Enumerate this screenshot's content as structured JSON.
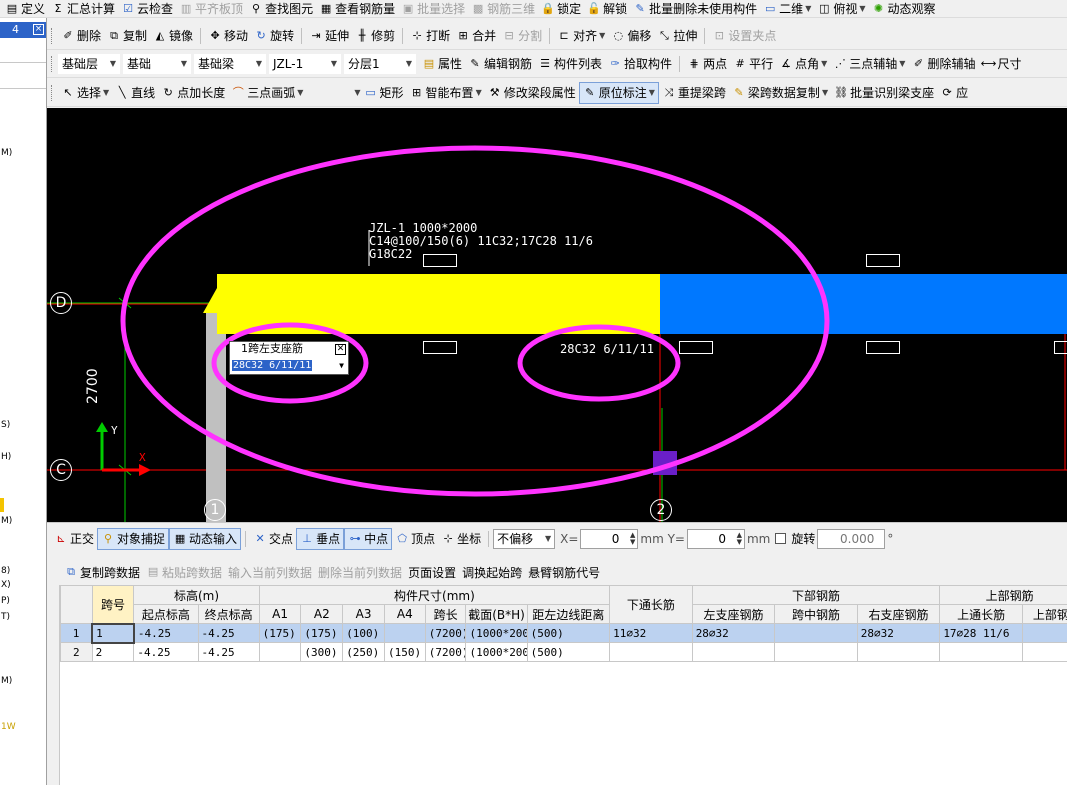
{
  "menu": {
    "items": [
      "定义",
      "汇总计算",
      "云检查",
      "平齐板顶",
      "查找图元",
      "查看钢筋量",
      "批量选择",
      "钢筋三维",
      "锁定",
      "解锁",
      "批量删除未使用构件",
      "二维",
      "俯视",
      "动态观察"
    ]
  },
  "toolbar1": {
    "items": [
      "删除",
      "复制",
      "镜像",
      "移动",
      "旋转",
      "延伸",
      "修剪",
      "打断",
      "合并",
      "分割",
      "对齐",
      "偏移",
      "拉伸",
      "设置夹点"
    ]
  },
  "toolbar2": {
    "floor": "基础层",
    "category": "基础",
    "type": "基础梁",
    "component": "JZL-1",
    "layer": "分层1",
    "items": [
      "属性",
      "编辑钢筋",
      "构件列表",
      "拾取构件",
      "两点",
      "平行",
      "点角",
      "三点辅轴",
      "删除辅轴",
      "尺寸"
    ]
  },
  "toolbar3": {
    "items": [
      "选择",
      "直线",
      "点加长度",
      "三点画弧",
      "矩形",
      "智能布置",
      "修改梁段属性",
      "原位标注",
      "重提梁跨",
      "梁跨数据复制",
      "批量识别梁支座",
      "应"
    ]
  },
  "canvas": {
    "beam_label_line1": "JZL-1 1000*2000",
    "beam_label_line2": "C14@100/150(6) 11C32;17C28 11/6",
    "beam_label_line3": "G18C22",
    "annotation_mid": "28C32 6/11/11",
    "dimension": "2700",
    "axis_d": "D",
    "axis_c": "C",
    "axis_1": "1",
    "axis_2": "2",
    "axis_x": "X",
    "axis_y": "Y",
    "popup_title": "1跨左支座筋",
    "popup_value": "28C32 6/11/11",
    "colors": {
      "beam_yellow": "#ffff00",
      "beam_blue": "#0078ff",
      "ellipse": "#ff33ff",
      "grid_red": "#ff0000",
      "grid_green": "#00cc00"
    }
  },
  "status": {
    "items": [
      "正交",
      "对象捕捉",
      "动态输入",
      "交点",
      "垂点",
      "中点",
      "顶点",
      "坐标"
    ],
    "offset_mode": "不偏移",
    "x_label": "X=",
    "x_value": "0",
    "y_label": "mm Y=",
    "y_value": "0",
    "unit": "mm",
    "rotate_label": "旋转",
    "rotate_value": "0.000",
    "degree": "°"
  },
  "grid_toolbar": {
    "items": [
      "复制跨数据",
      "粘贴跨数据",
      "输入当前列数据",
      "删除当前列数据",
      "页面设置",
      "调换起始跨",
      "悬臂钢筋代号"
    ]
  },
  "table": {
    "group_headers": {
      "elevation": "标高(m)",
      "size": "构件尺寸(mm)",
      "bottom_through": "下通长筋",
      "bottom": "下部钢筋",
      "top": "上部钢筋"
    },
    "headers": [
      "跨号",
      "起点标高",
      "终点标高",
      "A1",
      "A2",
      "A3",
      "A4",
      "跨长",
      "截面(B*H)",
      "距左边线距离",
      "左支座钢筋",
      "跨中钢筋",
      "右支座钢筋",
      "上通长筋",
      "上部钢"
    ],
    "rows": [
      {
        "n": "1",
        "span": "1",
        "start": "-4.25",
        "end": "-4.25",
        "a1": "(175)",
        "a2": "(175)",
        "a3": "(100)",
        "a4": "",
        "len": "(7200)",
        "sec": "(1000*200",
        "dist": "(500)",
        "bot_through": "11⌀32",
        "left": "28⌀32",
        "mid": "",
        "right": "28⌀32",
        "top_through": "17⌀28 11/6",
        "top": ""
      },
      {
        "n": "2",
        "span": "2",
        "start": "-4.25",
        "end": "-4.25",
        "a1": "",
        "a2": "(300)",
        "a3": "(250)",
        "a4": "(150)",
        "len": "(7200)",
        "sec": "(1000*200",
        "dist": "(500)",
        "bot_through": "",
        "left": "",
        "mid": "",
        "right": "",
        "top_through": "",
        "top": ""
      }
    ]
  },
  "left_panel": {
    "pin": "4",
    "close": "×",
    "frags": [
      "M)",
      "S)",
      "H)",
      "M)",
      "8)",
      "X)",
      "P)",
      "T)",
      "M)",
      "1W"
    ]
  }
}
